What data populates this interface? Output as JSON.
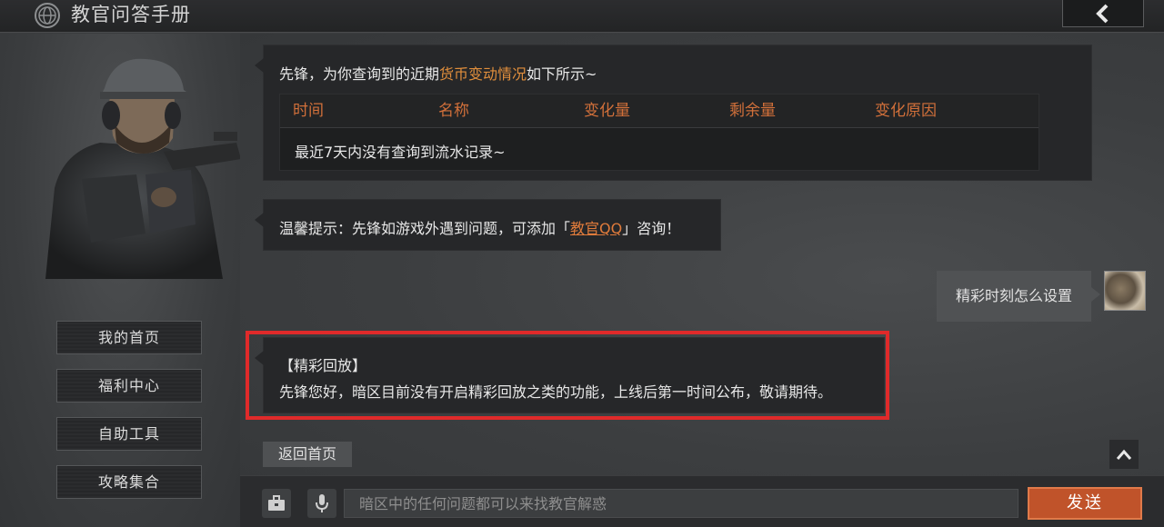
{
  "header": {
    "title": "教官问答手册",
    "globe_icon": "globe-icon",
    "back_icon": "chevron-left-icon"
  },
  "sidebar": {
    "nav": [
      {
        "label": "我的首页"
      },
      {
        "label": "福利中心"
      },
      {
        "label": "自助工具"
      },
      {
        "label": "攻略集合"
      }
    ]
  },
  "chat": {
    "msg1": {
      "prefix": "先锋，为你查询到的近期",
      "highlight": "货币变动情况",
      "suffix": "如下所示~",
      "table": {
        "columns": [
          "时间",
          "名称",
          "变化量",
          "剩余量",
          "变化原因"
        ],
        "empty_text": "最近7天内没有查询到流水记录~"
      }
    },
    "msg2": {
      "prefix": "温馨提示：先锋如游戏外遇到问题，可添加「",
      "link": "教官QQ",
      "suffix": "」咨询！"
    },
    "user_msg": "精彩时刻怎么设置",
    "msg3": {
      "line1": "【精彩回放】",
      "line2": "先锋您好，暗区目前没有开启精彩回放之类的功能，上线后第一时间公布，敬请期待。"
    },
    "return_button": "返回首页",
    "scroll_up_icon": "chevron-up-icon"
  },
  "input_bar": {
    "toolbox_icon": "toolbox-icon",
    "mic_icon": "microphone-icon",
    "placeholder": "暗区中的任何问题都可以来找教官解惑",
    "send_label": "发送"
  },
  "colors": {
    "accent_orange": "#e08e3c",
    "send_button": "#c0532a",
    "highlight_frame": "#e02a2a"
  }
}
